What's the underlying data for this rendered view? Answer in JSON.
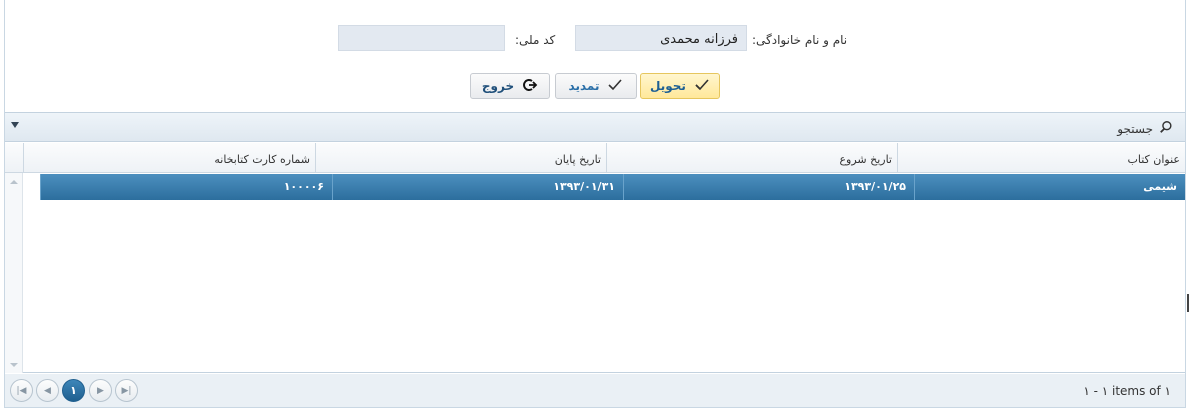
{
  "form": {
    "fullname_label": "نام و نام خانوادگی:",
    "fullname_value": "فرزانه محمدی",
    "national_code_label": "کد ملی:",
    "national_code_value": ""
  },
  "buttons": {
    "deliver": "تحویل",
    "renew": "تمدید",
    "exit": "خروج"
  },
  "search": {
    "label": "جستجو"
  },
  "grid": {
    "columns": [
      "عنوان کتاب",
      "تاریخ شروع",
      "تاریخ پایان",
      "شماره کارت کتابخانه"
    ],
    "rows": [
      [
        "شیمی",
        "۱۳۹۳/۰۱/۲۵",
        "۱۳۹۳/۰۱/۳۱",
        "۱۰۰۰۰۶"
      ]
    ]
  },
  "pager": {
    "current_page": "۱",
    "info": "۱ - ۱ items of ۱"
  },
  "icons": [
    "check-icon",
    "check-icon",
    "exit-icon",
    "search-icon",
    "dropdown-caret-icon",
    "first-page-icon",
    "prev-page-icon",
    "next-page-icon",
    "last-page-icon"
  ]
}
